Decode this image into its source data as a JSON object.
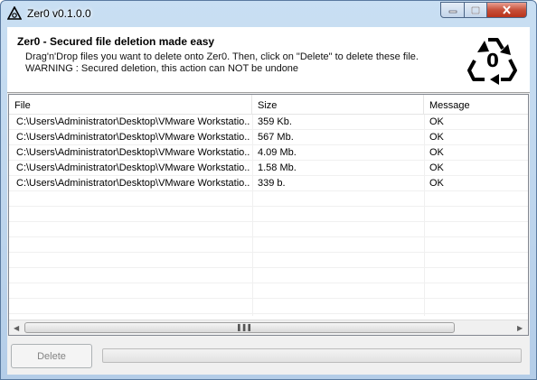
{
  "window": {
    "title": "Zer0 v0.1.0.0",
    "icon": "recycle-zero-icon",
    "controls": {
      "minimize": "minimize-icon",
      "maximize": "maximize-icon",
      "close": "close-icon"
    }
  },
  "header": {
    "title": "Zer0 - Secured file deletion made easy",
    "line1": "Drag'n'Drop files you want to delete onto Zer0. Then, click on \"Delete\" to delete these file.",
    "line2": "WARNING : Secured deletion, this action can NOT be undone",
    "logo_text": "0"
  },
  "list": {
    "columns": [
      "File",
      "Size",
      "Message"
    ],
    "rows": [
      {
        "file": "C:\\Users\\Administrator\\Desktop\\VMware Workstatio...",
        "size": "359 Kb.",
        "message": "OK"
      },
      {
        "file": "C:\\Users\\Administrator\\Desktop\\VMware Workstatio...",
        "size": "567 Mb.",
        "message": "OK"
      },
      {
        "file": "C:\\Users\\Administrator\\Desktop\\VMware Workstatio...",
        "size": "4.09 Mb.",
        "message": "OK"
      },
      {
        "file": "C:\\Users\\Administrator\\Desktop\\VMware Workstatio...",
        "size": "1.58 Mb.",
        "message": "OK"
      },
      {
        "file": "C:\\Users\\Administrator\\Desktop\\VMware Workstatio...",
        "size": "339  b.",
        "message": "OK"
      }
    ]
  },
  "footer": {
    "delete_label": "Delete",
    "progress": 0
  },
  "colors": {
    "title_bar": "#c9dff3",
    "close": "#c7503a",
    "progress_fill": "#37b521"
  }
}
